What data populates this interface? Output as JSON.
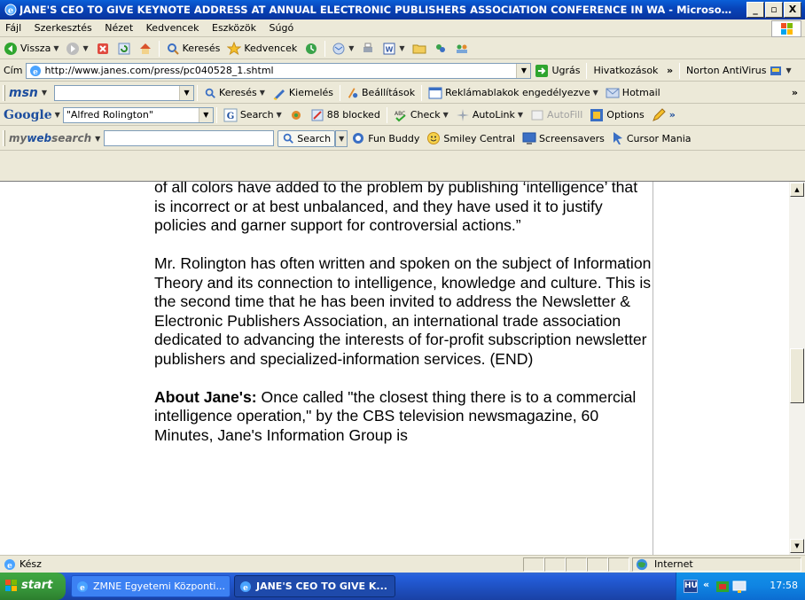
{
  "window": {
    "title": "JANE'S CEO TO GIVE KEYNOTE ADDRESS AT ANNUAL ELECTRONIC PUBLISHERS ASSOCIATION CONFERENCE IN WA - Microsoft Intern...",
    "controls": [
      "_",
      "▫",
      "X"
    ]
  },
  "menubar": {
    "items": [
      "Fájl",
      "Szerkesztés",
      "Nézet",
      "Kedvencek",
      "Eszközök",
      "Súgó"
    ]
  },
  "toolbar": {
    "back_label": "Vissza",
    "search_label": "Keresés",
    "favorites_label": "Kedvencek"
  },
  "addressbar": {
    "label": "Cím",
    "url": "http://www.janes.com/press/pc040528_1.shtml",
    "go_label": "Ugrás",
    "links_label": "Hivatkozások",
    "norton_label": "Norton AntiVirus"
  },
  "msnbar": {
    "logo": "msn",
    "search_label": "Keresés",
    "highlight_label": "Kiemelés",
    "settings_label": "Beállítások",
    "popups_label": "Reklámablakok engedélyezve",
    "hotmail_label": "Hotmail"
  },
  "googlebar": {
    "logo": "Google",
    "query": "\"Alfred Rolington\"",
    "search_label": "Search",
    "blocked_label": "88 blocked",
    "check_label": "Check",
    "autolink_label": "AutoLink",
    "autofill_label": "AutoFill",
    "options_label": "Options"
  },
  "mywebbar": {
    "logo_prefix": "my",
    "logo_main": "web",
    "logo_suffix": "search",
    "search_label": "Search",
    "funbuddy_label": "Fun Buddy",
    "smiley_label": "Smiley Central",
    "screensavers_label": "Screensavers",
    "cursor_label": "Cursor Mania"
  },
  "article": {
    "para1": "of all colors have added to the problem by publishing ‘intelligence’ that is incorrect or at best unbalanced, and they have used it to justify policies and garner support for controversial actions.”",
    "para2": "Mr. Rolington has often written and spoken on the subject of Information Theory and its connection to intelligence, knowledge and culture. This is the second time that he has been invited to address the Newsletter & Electronic Publishers Association, an international trade association dedicated to advancing the interests of for-profit subscription newsletter publishers and specialized-information services. (END)",
    "about_heading": "About Jane's:",
    "about_text": " Once called \"the closest thing there is to a commercial intelligence operation,\" by the CBS television newsmagazine, 60 Minutes, Jane's Information Group is"
  },
  "statusbar": {
    "status": "Kész",
    "zone": "Internet"
  },
  "taskbar": {
    "start_label": "start",
    "tasks": [
      {
        "label": "ZMNE Egyetemi Központi...",
        "active": false
      },
      {
        "label": "JANE'S CEO TO GIVE K...",
        "active": true
      }
    ],
    "tray_lang": "HU",
    "clock": "17:58"
  }
}
